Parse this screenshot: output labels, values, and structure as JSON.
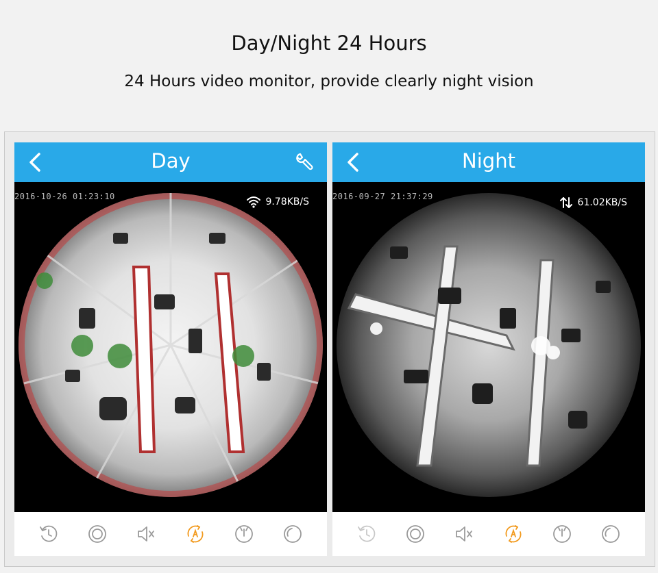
{
  "header": {
    "title": "Day/Night 24 Hours",
    "subtitle": "24 Hours video monitor, provide clearly night vision"
  },
  "panels": {
    "day": {
      "title": "Day",
      "timestamp": "2016-10-26 01:23:10",
      "rate": "9.78KB/S",
      "rate_icon": "wifi-icon",
      "has_settings": true
    },
    "night": {
      "title": "Night",
      "timestamp": "2016-09-27 21:37:29",
      "rate": "61.02KB/S",
      "rate_icon": "transfer-arrows-icon"
    }
  },
  "controls": [
    "replay-icon",
    "record-icon",
    "mute-icon",
    "auto-rotate-icon",
    "mode-icon",
    "capture-icon"
  ],
  "colors": {
    "accent": "#29a9e8",
    "auto_icon": "#f29a1e",
    "control_icon": "#9a9a9a",
    "background": "#f2f2f2"
  }
}
